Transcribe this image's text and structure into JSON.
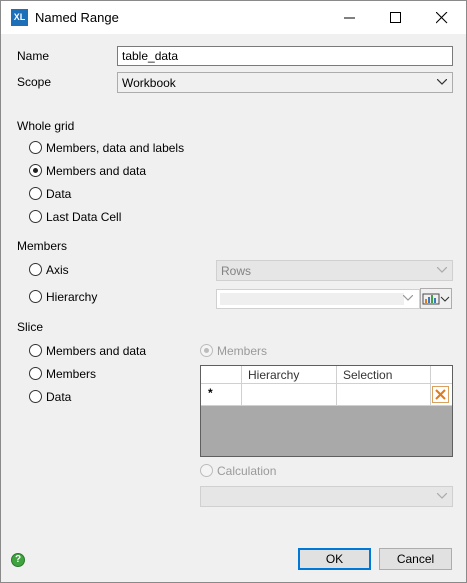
{
  "window": {
    "title": "Named Range",
    "icon_label": "XL"
  },
  "form": {
    "name_label": "Name",
    "name_value": "table_data",
    "scope_label": "Scope",
    "scope_value": "Workbook"
  },
  "whole_grid": {
    "heading": "Whole grid",
    "options": [
      {
        "label": "Members, data and labels",
        "checked": false
      },
      {
        "label": "Members and data",
        "checked": true
      },
      {
        "label": "Data",
        "checked": false
      },
      {
        "label": "Last Data Cell",
        "checked": false
      }
    ]
  },
  "members": {
    "heading": "Members",
    "axis_label": "Axis",
    "axis_value": "Rows",
    "hierarchy_label": "Hierarchy",
    "hierarchy_value": ""
  },
  "slice": {
    "heading": "Slice",
    "options": [
      {
        "label": "Members and data",
        "checked": false
      },
      {
        "label": "Members",
        "checked": false
      },
      {
        "label": "Data",
        "checked": false
      }
    ],
    "members_radio_label": "Members",
    "calculation_radio_label": "Calculation",
    "grid": {
      "columns": [
        "Hierarchy",
        "Selection"
      ],
      "new_row_marker": "*"
    },
    "calculation_value": ""
  },
  "buttons": {
    "ok": "OK",
    "cancel": "Cancel",
    "help": "?"
  },
  "colors": {
    "accent": "#0078d7",
    "help_green": "#3fa33f",
    "delete_orange": "#e07b1a"
  }
}
